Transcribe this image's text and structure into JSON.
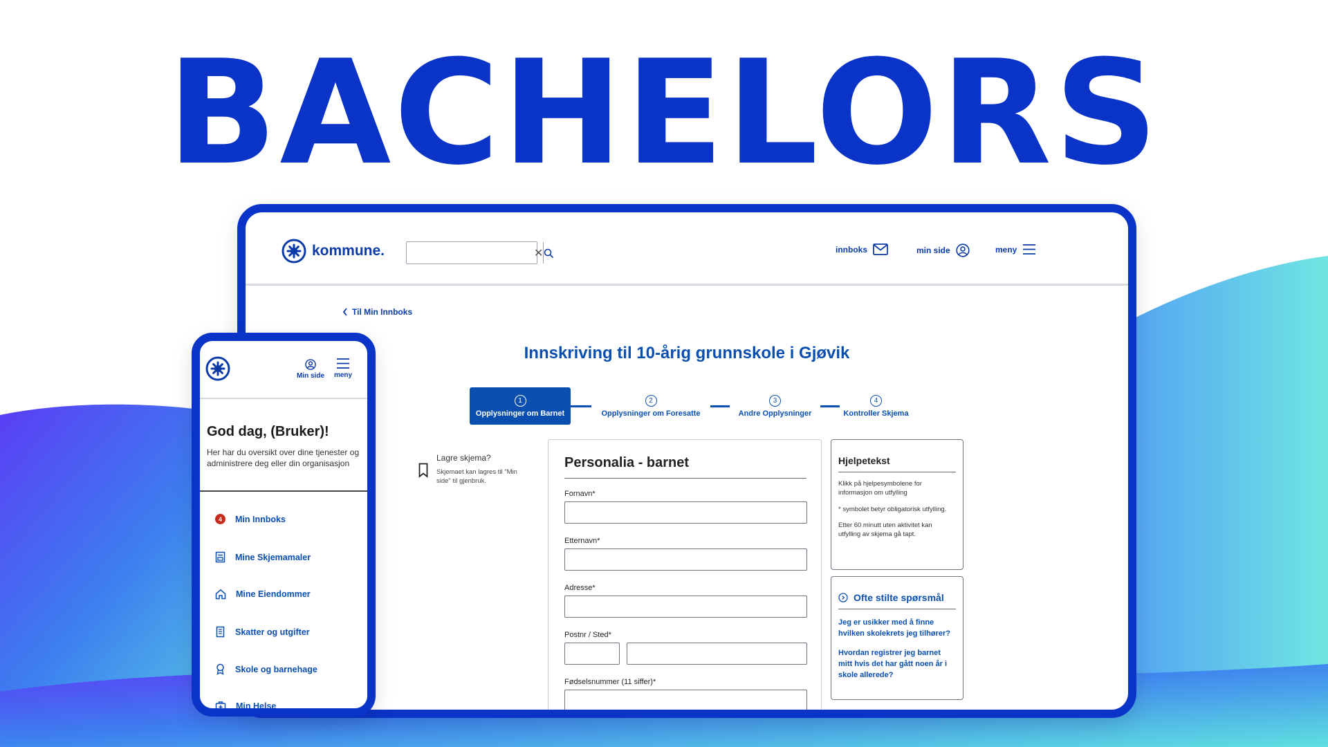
{
  "hero": {
    "title": "BACHELORS"
  },
  "colors": {
    "brand_blue": "#0a34c8",
    "link_blue": "#0a4fb0",
    "badge_red": "#c42b1c",
    "wave_purple": "#5b3df5",
    "wave_cyan": "#5fe0e0"
  },
  "desktop": {
    "logo_text": "kommune.",
    "search": {
      "placeholder": "",
      "clear_icon": "close-icon",
      "button_icon": "search-icon"
    },
    "nav": {
      "inbox_label": "innboks",
      "my_page_label": "min side",
      "menu_label": "meny"
    },
    "back_link": "Til Min Innboks",
    "page_title": "Innskriving til 10-årig grunnskole i Gjøvik",
    "steps": [
      {
        "number": "1",
        "label": "Opplysninger om Barnet",
        "active": true
      },
      {
        "number": "2",
        "label": "Opplysninger om Foresatte",
        "active": false
      },
      {
        "number": "3",
        "label": "Andre Opplysninger",
        "active": false
      },
      {
        "number": "4",
        "label": "Kontroller Skjema",
        "active": false
      }
    ],
    "save": {
      "title": "Lagre skjema?",
      "description": "Skjemaet kan lagres til \"Min side\" til gjenbruk."
    },
    "form": {
      "title": "Personalia - barnet",
      "fields": {
        "first_name": "Fornavn*",
        "last_name": "Etternavn*",
        "address": "Adresse*",
        "postal": "Postnr / Sted*",
        "ssn": "Fødselsnummer (11 siffer)*"
      }
    },
    "help": {
      "title": "Hjelpetekst",
      "lines": [
        "Klikk på hjelpesymbolene for informasjon om utfylling",
        "* symbolet betyr obligatorisk utfylling.",
        "Etter 60 minutt uten aktivitet kan utfylling av skjema gå tapt."
      ]
    },
    "faq": {
      "title": "Ofte stilte spørsmål",
      "questions": [
        "Jeg er usikker med å finne hvilken skolekrets jeg tilhører?",
        "Hvordan registrer jeg barnet mitt hvis det har gått noen år i skole allerede?"
      ]
    }
  },
  "mobile": {
    "nav": {
      "my_page_label": "Min side",
      "menu_label": "meny"
    },
    "greeting": {
      "title": "God dag, (Bruker)!",
      "description": "Her har du oversikt over dine tjenester og administrere deg eller din organisasjon"
    },
    "menu": [
      {
        "label": "Min Innboks",
        "icon": "inbox-badge-icon",
        "badge": "4"
      },
      {
        "label": "Mine Skjemamaler",
        "icon": "form-template-icon"
      },
      {
        "label": "Mine Eiendommer",
        "icon": "house-icon"
      },
      {
        "label": "Skatter og utgifter",
        "icon": "receipt-icon"
      },
      {
        "label": "Skole og barnehage",
        "icon": "school-badge-icon"
      },
      {
        "label": "Min Helse",
        "icon": "health-kit-icon"
      }
    ]
  }
}
